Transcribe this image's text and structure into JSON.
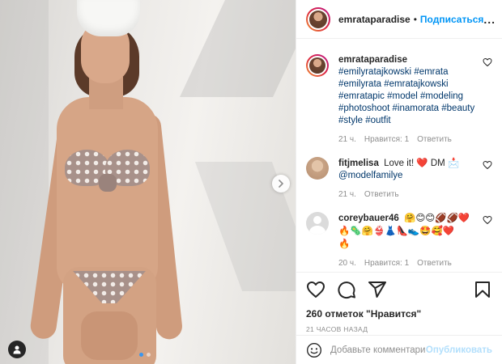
{
  "header": {
    "username": "emrataparadise",
    "separator": "•",
    "follow_label": "Подписаться",
    "more_label": "..."
  },
  "caption": {
    "username": "emrataparadise",
    "hashtags": [
      "#emilyratajkowski",
      "#emrata",
      "#emilyrata",
      "#emratajkowski",
      "#emratapic",
      "#model",
      "#modeling",
      "#photoshoot",
      "#inamorata",
      "#beauty",
      "#style",
      "#outfit"
    ],
    "time": "21 ч.",
    "likes": "Нравится: 1",
    "reply": "Ответить"
  },
  "comments": [
    {
      "username": "fitjmelisa",
      "text": "Love it!",
      "emoji1": "❤️",
      "text2": "DM",
      "emoji2": "📩",
      "mention": "@modelfamilye",
      "time": "21 ч.",
      "reply": "Ответить"
    },
    {
      "username": "coreybauer46",
      "emoji_line1": "🤗😊😊🏈🏈❤️",
      "emoji_line2": "🔥🦠🤗👙👗👠👟🤩🥰❤️",
      "emoji_line3": "🔥",
      "time": "20 ч.",
      "likes": "Нравится: 1",
      "reply": "Ответить"
    }
  ],
  "actions": {
    "likes_text": "260 отметок \"Нравится\"",
    "timestamp": "21 ЧАСОВ НАЗАД"
  },
  "add_comment": {
    "placeholder": "Добавьте комментарий...",
    "publish_label": "Опубликовать"
  },
  "media": {
    "slide_count": 2,
    "active_slide": 1
  },
  "icons": {
    "heart": "heart-icon",
    "comment": "comment-icon",
    "share": "share-icon",
    "save": "bookmark-icon",
    "next": "chevron-right-icon",
    "tag": "user-tag-icon",
    "smile": "smile-icon"
  },
  "colors": {
    "accent": "#0095f6",
    "publish_disabled": "#b2dffc",
    "muted": "#8e8e8e",
    "link": "#00376b",
    "active_dot": "#3897f0"
  }
}
